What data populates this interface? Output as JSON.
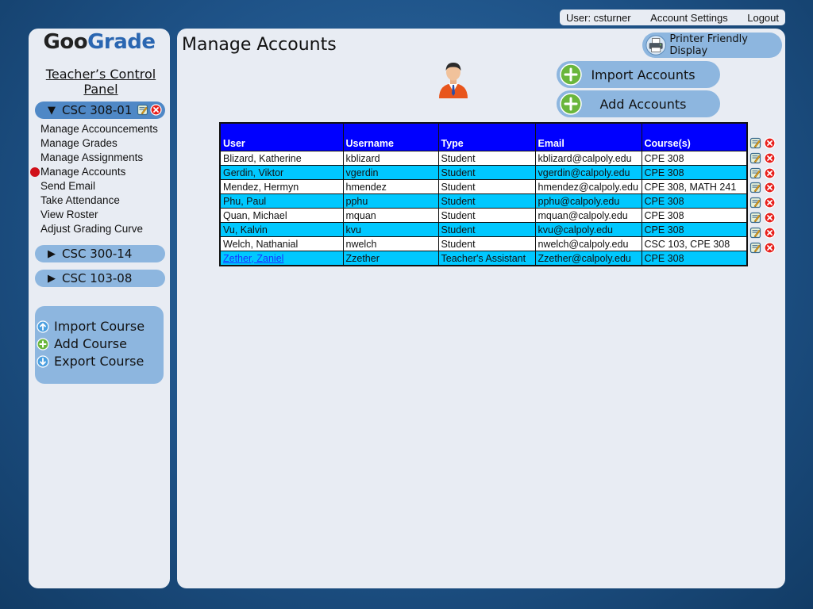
{
  "topbar": {
    "user": "User: csturner",
    "account_settings": "Account Settings",
    "logout": "Logout"
  },
  "logo": {
    "part1": "Goo",
    "part2": "Grade"
  },
  "sidebar": {
    "title": "Teacher’s Control Panel",
    "courses": [
      {
        "label": "CSC 308-01",
        "expanded": true
      },
      {
        "label": "CSC 300-14",
        "expanded": false
      },
      {
        "label": "CSC 103-08",
        "expanded": false
      }
    ],
    "menu": [
      "Manage Accouncements",
      "Manage Grades",
      "Manage Assignments",
      "Manage Accounts",
      "Send Email",
      "Take Attendance",
      "View Roster",
      "Adjust Grading Curve"
    ],
    "active_menu": "Manage Accounts",
    "course_actions": [
      "Import Course",
      "Add Course",
      "Export Course"
    ]
  },
  "main": {
    "title": "Manage Accounts",
    "printer_label": "Printer Friendly Display",
    "import_label": "Import Accounts",
    "add_label": "Add Accounts"
  },
  "table": {
    "headers": [
      "User",
      "Username",
      "Type",
      "Email",
      "Course(s)"
    ],
    "rows": [
      [
        "Blizard, Katherine",
        "kblizard",
        "Student",
        "kblizard@calpoly.edu",
        "CPE 308"
      ],
      [
        "Gerdin, Viktor",
        "vgerdin",
        "Student",
        "vgerdin@calpoly.edu",
        "CPE 308"
      ],
      [
        "Mendez, Hermyn",
        "hmendez",
        "Student",
        "hmendez@calpoly.edu",
        "CPE 308, MATH 241"
      ],
      [
        "Phu, Paul",
        "pphu",
        "Student",
        "pphu@calpoly.edu",
        "CPE 308"
      ],
      [
        "Quan, Michael",
        "mquan",
        "Student",
        "mquan@calpoly.edu",
        "CPE 308"
      ],
      [
        "Vu, Kalvin",
        "kvu",
        "Student",
        "kvu@calpoly.edu",
        "CPE 308"
      ],
      [
        "Welch, Nathanial",
        "nwelch",
        "Student",
        "nwelch@calpoly.edu",
        "CSC 103, CPE 308"
      ],
      [
        "Zether, Zaniel",
        "Zzether",
        "Teacher's Assistant",
        "Zzether@calpoly.edu",
        "CPE 308"
      ]
    ]
  },
  "colors": {
    "background": "#1e5287",
    "panel": "#e8ecf3",
    "pill": "#8db6df",
    "header": "#0000ff",
    "row_alt": "#00c8ff",
    "link": "#1a33ff"
  }
}
